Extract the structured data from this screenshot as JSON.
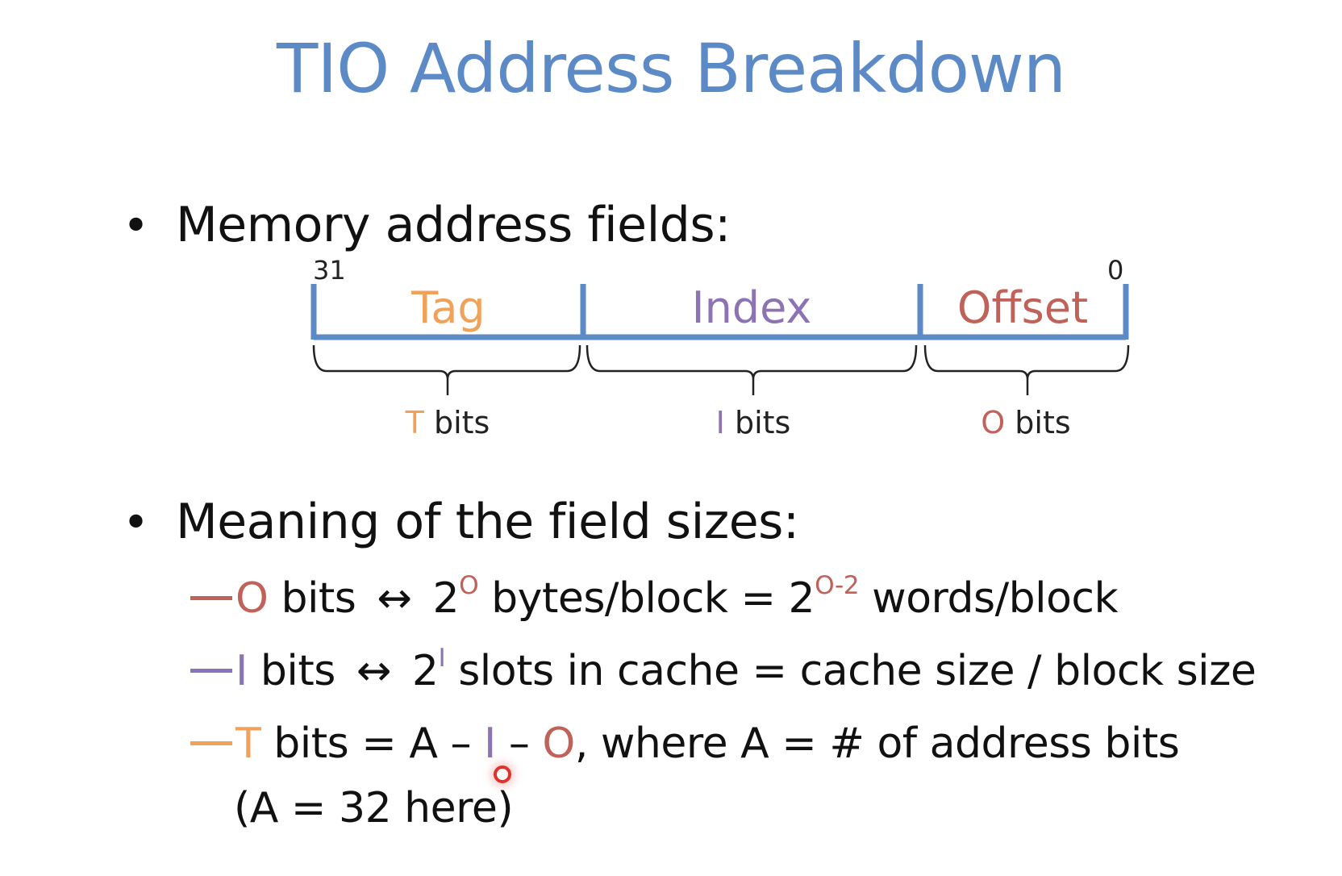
{
  "slide": {
    "title": "TIO Address Breakdown",
    "bullet1": "Memory address fields:",
    "bullet2": "Meaning of the field sizes:"
  },
  "diagram": {
    "bit_high": "31",
    "bit_low": "0",
    "fields": [
      {
        "name": "Tag",
        "color": "#f0a25a"
      },
      {
        "name": "Index",
        "color": "#8c73b4"
      },
      {
        "name": "Offset",
        "color": "#c0625a"
      }
    ],
    "sizes": [
      {
        "var": "T",
        "unit": " bits"
      },
      {
        "var": "I",
        "unit": " bits"
      },
      {
        "var": "O",
        "unit": " bits"
      }
    ],
    "line_color": "#5b8ac6"
  },
  "meanings": {
    "line1": {
      "var": "O",
      "text_a": " bits",
      "arrow": "↔",
      "base1": "2",
      "exp1": "O",
      "text_b": " bytes/block = 2",
      "exp2": "O-2",
      "text_c": " words/block"
    },
    "line2": {
      "var": "I",
      "text_a": " bits",
      "arrow": "↔",
      "base1": "2",
      "exp1": "I",
      "text_b": " slots in cache = cache size / block size"
    },
    "line3": {
      "var": "T",
      "text_a": " bits = A – ",
      "var_i": "I",
      "text_b": " – ",
      "var_o": "O",
      "text_c": ", where A = # of address bits",
      "text_d": "(A = 32 here)"
    }
  },
  "colors": {
    "title": "#5b8ac6",
    "tag": "#f0a25a",
    "index": "#8c73b4",
    "offset": "#c0625a",
    "cursor": "#e0322c"
  }
}
